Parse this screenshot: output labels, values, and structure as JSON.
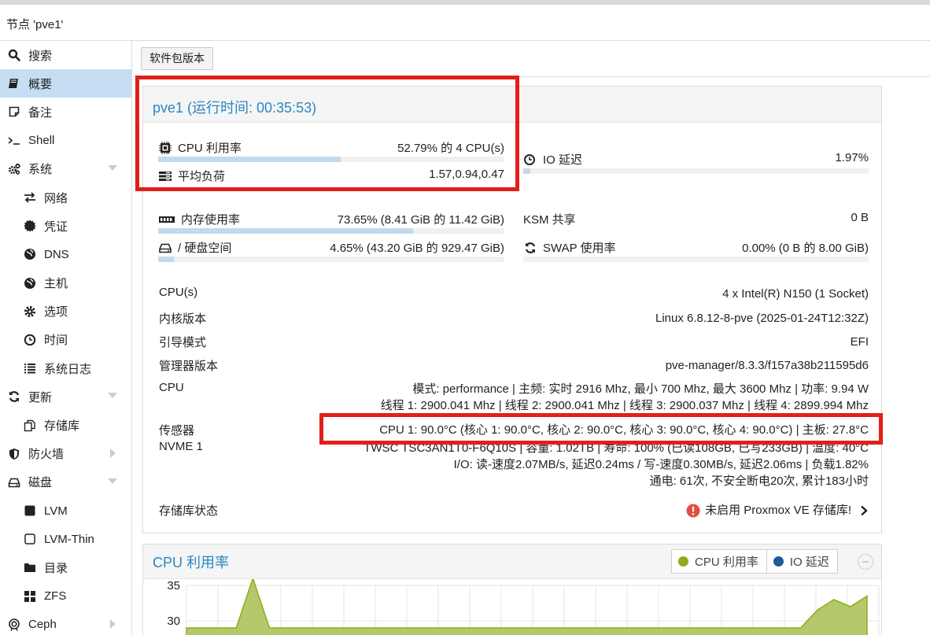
{
  "window": {
    "title": "节点 'pve1'"
  },
  "sidebar": {
    "items": [
      {
        "label": "搜索",
        "icon": "search-icon"
      },
      {
        "label": "概要",
        "icon": "book-icon",
        "active": true
      },
      {
        "label": "备注",
        "icon": "note-icon"
      },
      {
        "label": "Shell",
        "icon": "terminal-icon"
      },
      {
        "label": "系统",
        "icon": "gears-icon",
        "expandable": true
      },
      {
        "label": "网络",
        "icon": "exchange-icon",
        "sub": true
      },
      {
        "label": "凭证",
        "icon": "certificate-icon",
        "sub": true
      },
      {
        "label": "DNS",
        "icon": "globe-icon",
        "sub": true
      },
      {
        "label": "主机",
        "icon": "globe-icon",
        "sub": true
      },
      {
        "label": "选项",
        "icon": "gear-icon",
        "sub": true
      },
      {
        "label": "时间",
        "icon": "clock-icon",
        "sub": true
      },
      {
        "label": "系统日志",
        "icon": "list-icon",
        "sub": true
      },
      {
        "label": "更新",
        "icon": "refresh-icon",
        "expandable": true
      },
      {
        "label": "存储库",
        "icon": "files-icon",
        "sub": true
      },
      {
        "label": "防火墙",
        "icon": "shield-icon",
        "collapsed": true
      },
      {
        "label": "磁盘",
        "icon": "hdd-icon",
        "expandable": true
      },
      {
        "label": "LVM",
        "icon": "square-icon",
        "sub": true
      },
      {
        "label": "LVM-Thin",
        "icon": "square-outline-icon",
        "sub": true
      },
      {
        "label": "目录",
        "icon": "folder-icon",
        "sub": true
      },
      {
        "label": "ZFS",
        "icon": "grid-icon",
        "sub": true
      },
      {
        "label": "Ceph",
        "icon": "ceph-icon",
        "collapsed": true
      }
    ]
  },
  "toolbar": {
    "package_versions_label": "软件包版本"
  },
  "summary": {
    "title": "pve1 (运行时间: 00:35:53)",
    "cpu": {
      "label": "CPU 利用率",
      "value": "52.79% 的 4 CPU(s)",
      "fraction": 0.5279
    },
    "load": {
      "label": "平均负荷",
      "value": "1.57,0.94,0.47"
    },
    "io": {
      "label": "IO 延迟",
      "value": "1.97%",
      "fraction": 0.0197
    },
    "memory": {
      "label": "内存使用率",
      "value": "73.65% (8.41 GiB 的 11.42 GiB)",
      "fraction": 0.7365
    },
    "ksm": {
      "label": "KSM 共享",
      "value": "0 B"
    },
    "disk": {
      "label": "/ 硬盘空间",
      "value": "4.65% (43.20 GiB 的 929.47 GiB)",
      "fraction": 0.0465
    },
    "swap": {
      "label": "SWAP 使用率",
      "value": "0.00% (0 B 的 8.00 GiB)",
      "fraction": 0
    }
  },
  "info": {
    "cpus": {
      "label": "CPU(s)",
      "value": "4 x Intel(R) N150 (1 Socket)"
    },
    "kernel": {
      "label": "内核版本",
      "value": "Linux 6.8.12-8-pve (2025-01-24T12:32Z)"
    },
    "boot": {
      "label": "引导模式",
      "value": "EFI"
    },
    "manager": {
      "label": "管理器版本",
      "value": "pve-manager/8.3.3/f157a38b211595d6"
    },
    "cpu_freq": {
      "label": "CPU",
      "line1": "模式: performance | 主频: 实时 2916 Mhz, 最小 700 Mhz, 最大 3600 Mhz | 功率: 9.94 W",
      "line2": "线程 1: 2900.041 Mhz | 线程 2: 2900.041 Mhz | 线程 3: 2900.037 Mhz | 线程 4: 2899.994 Mhz"
    },
    "sensors": {
      "label": "传感器",
      "value": "CPU 1: 90.0°C (核心 1: 90.0°C, 核心 2: 90.0°C, 核心 3: 90.0°C, 核心 4: 90.0°C) | 主板: 27.8°C"
    },
    "nvme": {
      "label": "NVME 1",
      "line1": "TWSC TSC3AN1T0-F6Q10S | 容量: 1.02TB | 寿命: 100% (已读108GB, 已写233GB) | 温度: 40°C",
      "line2": "I/O: 读-速度2.07MB/s, 延迟0.24ms / 写-速度0.30MB/s, 延迟2.06ms | 负载1.82%",
      "line3": "通电: 61次, 不安全断电20次, 累计183小时"
    },
    "repo": {
      "label": "存储库状态",
      "value": "未启用 Proxmox VE 存储库!"
    }
  },
  "chart": {
    "title": "CPU 利用率",
    "legend": [
      {
        "name": "CPU 利用率",
        "color": "#8fac1b"
      },
      {
        "name": "IO 延迟",
        "color": "#1e5a9c"
      }
    ]
  },
  "chart_data": {
    "type": "area",
    "title": "CPU 利用率",
    "y_ticks": [
      "35",
      "30"
    ],
    "ylim": [
      30,
      35
    ],
    "grid": true,
    "legend_position": "top-right",
    "series": [
      {
        "name": "CPU 利用率",
        "color": "#8fac1b",
        "values": [
          29,
          29,
          29,
          29,
          36,
          29,
          29,
          29,
          29,
          29,
          29,
          29,
          29,
          29,
          29,
          29,
          29,
          29,
          29,
          29,
          29,
          29,
          29,
          29,
          29,
          29,
          29,
          29,
          29,
          29,
          29,
          29,
          29,
          29,
          29,
          29,
          29,
          29,
          31.5,
          33,
          32,
          33.5
        ]
      },
      {
        "name": "IO 延迟",
        "color": "#1e5a9c",
        "values": []
      }
    ]
  },
  "colors": {
    "accent": "#2b86c4",
    "highlight": "#e0201b",
    "active_bg": "#c5def3",
    "bar_fill": "#c2daee"
  }
}
